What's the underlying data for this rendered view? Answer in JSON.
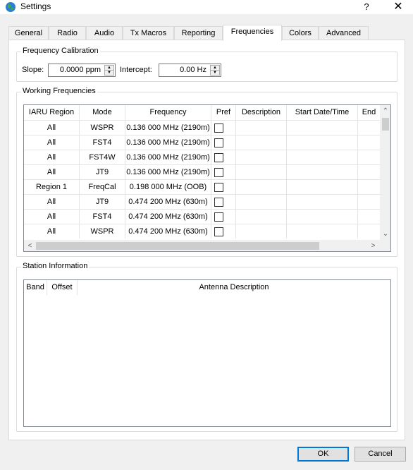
{
  "window": {
    "title": "Settings",
    "help": "?",
    "close": "✕"
  },
  "tabs": [
    {
      "label": "General"
    },
    {
      "label": "Radio"
    },
    {
      "label": "Audio"
    },
    {
      "label": "Tx Macros"
    },
    {
      "label": "Reporting"
    },
    {
      "label": "Frequencies",
      "active": true
    },
    {
      "label": "Colors"
    },
    {
      "label": "Advanced"
    }
  ],
  "calibration": {
    "title": "Frequency Calibration",
    "slope_label": "Slope:",
    "slope_value": "0.0000 ppm",
    "intercept_label": "Intercept:",
    "intercept_value": "0.00 Hz"
  },
  "working": {
    "title": "Working Frequencies",
    "columns": [
      "IARU Region",
      "Mode",
      "Frequency",
      "Pref",
      "Description",
      "Start Date/Time",
      "End"
    ],
    "rows": [
      {
        "region": "All",
        "mode": "WSPR",
        "freq": "0.136 000 MHz (2190m)",
        "pref": false
      },
      {
        "region": "All",
        "mode": "FST4",
        "freq": "0.136 000 MHz (2190m)",
        "pref": false
      },
      {
        "region": "All",
        "mode": "FST4W",
        "freq": "0.136 000 MHz (2190m)",
        "pref": false
      },
      {
        "region": "All",
        "mode": "JT9",
        "freq": "0.136 000 MHz (2190m)",
        "pref": false
      },
      {
        "region": "Region 1",
        "mode": "FreqCal",
        "freq": "0.198 000 MHz (OOB)",
        "pref": false
      },
      {
        "region": "All",
        "mode": "JT9",
        "freq": "0.474 200 MHz (630m)",
        "pref": false
      },
      {
        "region": "All",
        "mode": "FST4",
        "freq": "0.474 200 MHz (630m)",
        "pref": false
      },
      {
        "region": "All",
        "mode": "WSPR",
        "freq": "0.474 200 MHz (630m)",
        "pref": false
      }
    ]
  },
  "station": {
    "title": "Station Information",
    "columns": [
      "Band",
      "Offset",
      "Antenna Description"
    ]
  },
  "buttons": {
    "ok": "OK",
    "cancel": "Cancel"
  },
  "colors": {
    "accent": "#0078d7",
    "panel": "#ffffff",
    "background": "#f0f0f0"
  }
}
